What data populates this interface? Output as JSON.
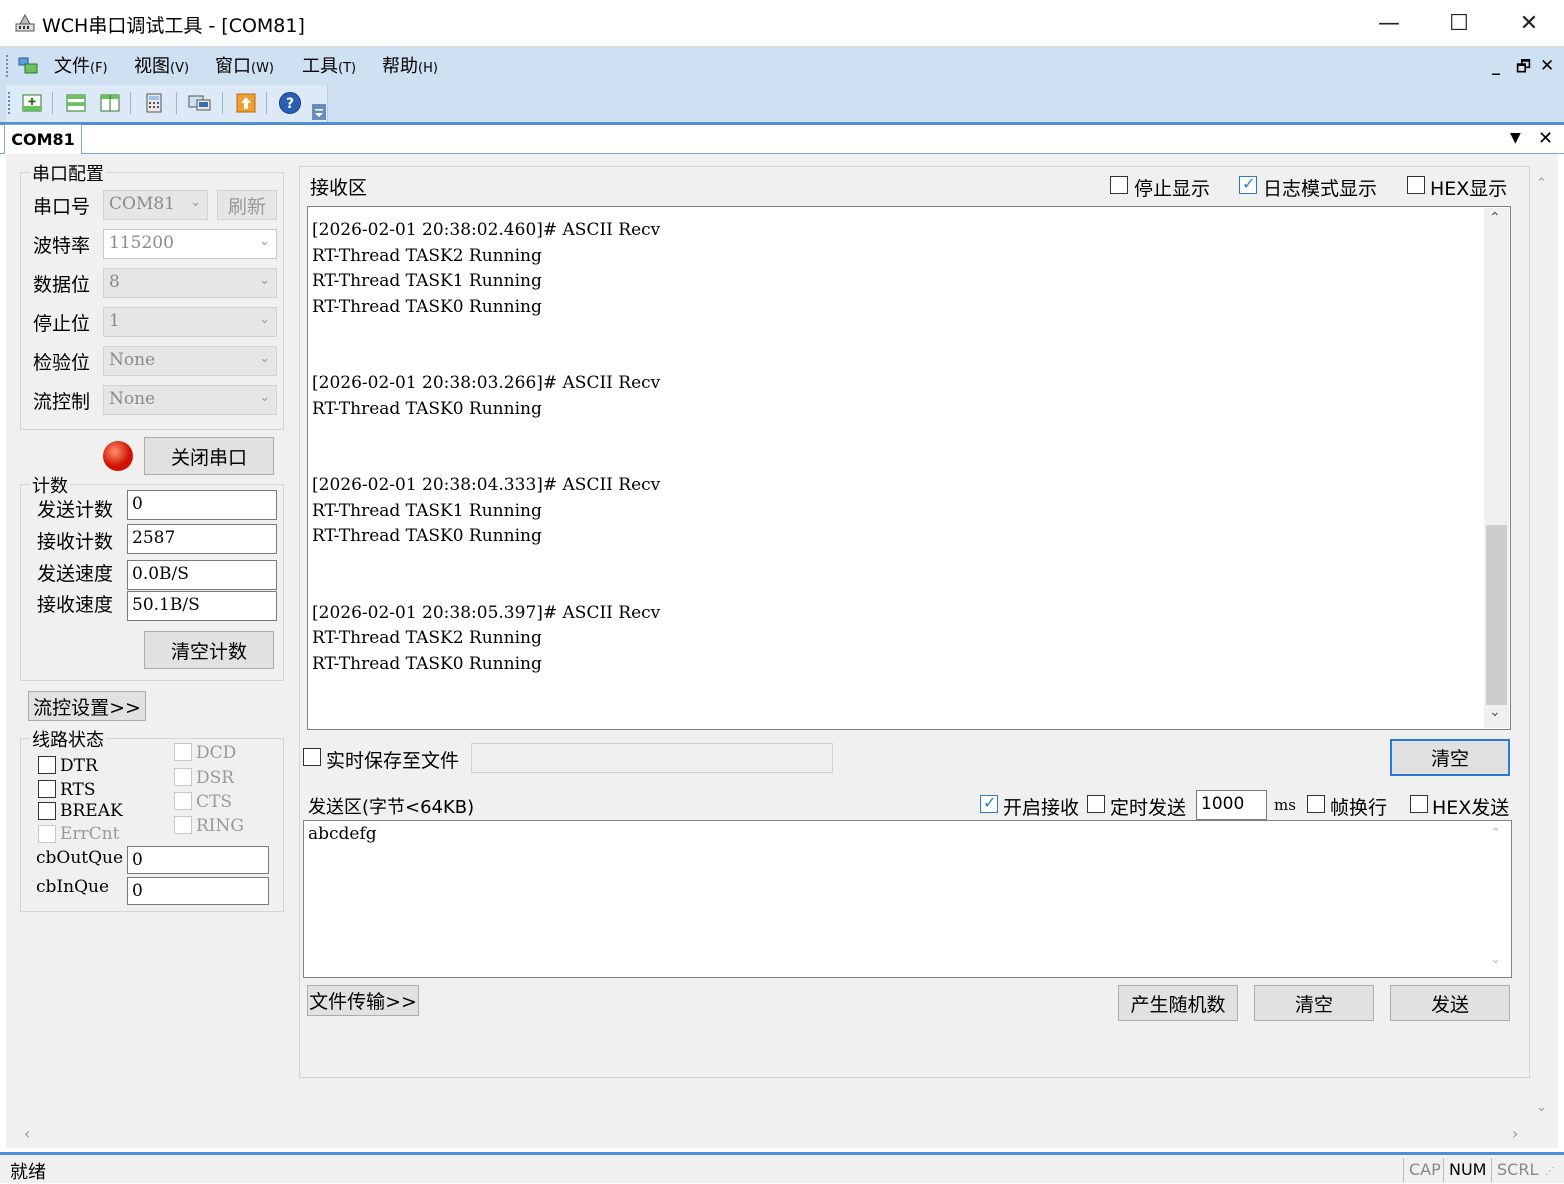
{
  "window": {
    "title": "WCH串口调试工具 - [COM81]",
    "minimize": "—",
    "maximize": "☐",
    "close": "✕"
  },
  "menu": {
    "items": [
      {
        "label": "文件",
        "key": "(F)"
      },
      {
        "label": "视图",
        "key": "(V)"
      },
      {
        "label": "窗口",
        "key": "(W)"
      },
      {
        "label": "工具",
        "key": "(T)"
      },
      {
        "label": "帮助",
        "key": "(H)"
      }
    ],
    "mdi_min": "_",
    "mdi_restore": "🗗",
    "mdi_close": "✕"
  },
  "tabs": {
    "active": "COM81",
    "dropdown": "▼",
    "close": "✕"
  },
  "serial_config": {
    "title": "串口配置",
    "port_label": "串口号",
    "port_value": "COM81",
    "refresh_label": "刷新",
    "baud_label": "波特率",
    "baud_value": "115200",
    "databits_label": "数据位",
    "databits_value": "8",
    "stopbits_label": "停止位",
    "stopbits_value": "1",
    "parity_label": "检验位",
    "parity_value": "None",
    "flow_label": "流控制",
    "flow_value": "None",
    "close_port_label": "关闭串口"
  },
  "counters": {
    "title": "计数",
    "send_count_label": "发送计数",
    "send_count": "0",
    "recv_count_label": "接收计数",
    "recv_count": "2587",
    "send_speed_label": "发送速度",
    "send_speed": "0.0B/S",
    "recv_speed_label": "接收速度",
    "recv_speed": "50.1B/S",
    "clear_label": "清空计数"
  },
  "flow_settings_label": "流控设置>>",
  "line_status": {
    "title": "线路状态",
    "dtr": "DTR",
    "rts": "RTS",
    "brk": "BREAK",
    "errcnt": "ErrCnt",
    "dcd": "DCD",
    "dsr": "DSR",
    "cts": "CTS",
    "ring": "RING",
    "outque_label": "cbOutQue",
    "outque": "0",
    "inque_label": "cbInQue",
    "inque": "0"
  },
  "receive": {
    "title": "接收区",
    "stop_display": "停止显示",
    "log_mode": "日志模式显示",
    "log_mode_checked": true,
    "hex_display": "HEX显示",
    "text": "[2026-02-01 20:38:02.460]# ASCII Recv\nRT-Thread TASK2 Running\nRT-Thread TASK1 Running\nRT-Thread TASK0 Running\n\n\n[2026-02-01 20:38:03.266]# ASCII Recv\nRT-Thread TASK0 Running\n\n\n[2026-02-01 20:38:04.333]# ASCII Recv\nRT-Thread TASK1 Running\nRT-Thread TASK0 Running\n\n\n[2026-02-01 20:38:05.397]# ASCII Recv\nRT-Thread TASK2 Running\nRT-Thread TASK0 Running",
    "save_to_file": "实时保存至文件",
    "save_path": "",
    "clear_label": "清空"
  },
  "send": {
    "title": "发送区(字节<64KB)",
    "enable_recv": "开启接收",
    "enable_recv_checked": true,
    "timed_send": "定时发送",
    "interval": "1000",
    "interval_unit": "ms",
    "frame_newline": "帧换行",
    "hex_send": "HEX发送",
    "text": "abcdefg",
    "file_transfer_label": "文件传输>>",
    "random_label": "产生随机数",
    "clear_label": "清空",
    "send_label": "发送"
  },
  "status": {
    "ready": "就绪",
    "cap": "CAP",
    "num": "NUM",
    "scrl": "SCRL"
  },
  "colors": {
    "menubar": "#cfe0f3",
    "accent": "#4f8fd6",
    "led": "#e02010"
  }
}
